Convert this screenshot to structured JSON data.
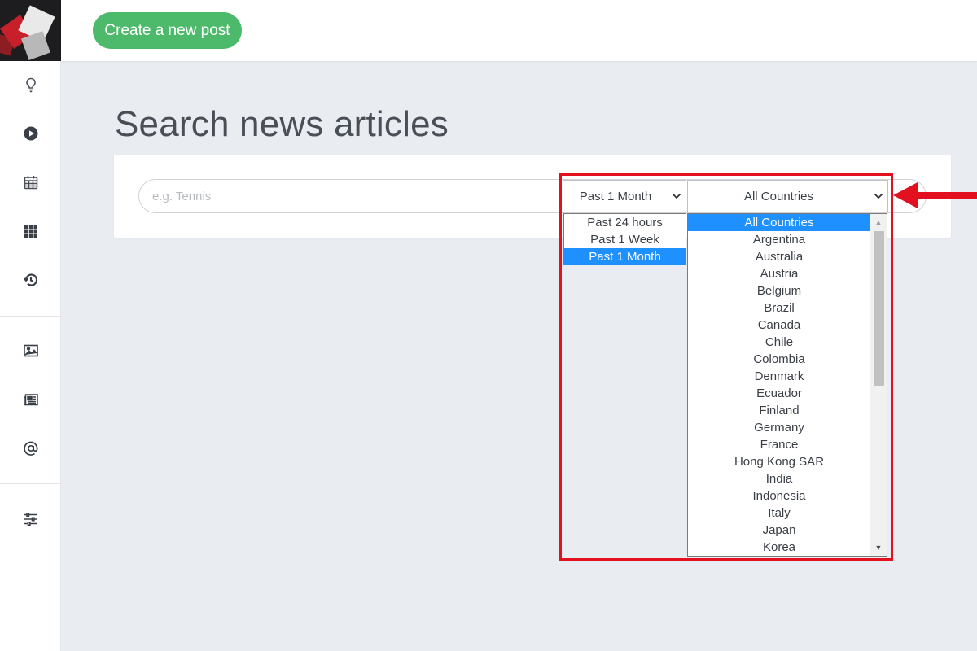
{
  "topbar": {
    "create_label": "Create a new post"
  },
  "page": {
    "title": "Search news articles"
  },
  "search": {
    "placeholder": "e.g. Tennis",
    "value": ""
  },
  "time_filter": {
    "selected": "Past 1 Month",
    "options": [
      "Past 24 hours",
      "Past 1 Week",
      "Past 1 Month"
    ]
  },
  "country_filter": {
    "selected": "All Countries",
    "options": [
      "All Countries",
      "Argentina",
      "Australia",
      "Austria",
      "Belgium",
      "Brazil",
      "Canada",
      "Chile",
      "Colombia",
      "Denmark",
      "Ecuador",
      "Finland",
      "Germany",
      "France",
      "Hong Kong SAR",
      "India",
      "Indonesia",
      "Italy",
      "Japan",
      "Korea"
    ]
  },
  "sidebar": {
    "icons": [
      "lightbulb-icon",
      "play-icon",
      "calendar-icon",
      "grid-icon",
      "history-icon",
      "image-icon",
      "newspaper-icon",
      "at-icon",
      "sliders-icon"
    ]
  },
  "colors": {
    "accent_green": "#4cba6a",
    "selection_blue": "#1e90ff",
    "highlight_red": "#e3101f",
    "background": "#e9ecf0"
  }
}
